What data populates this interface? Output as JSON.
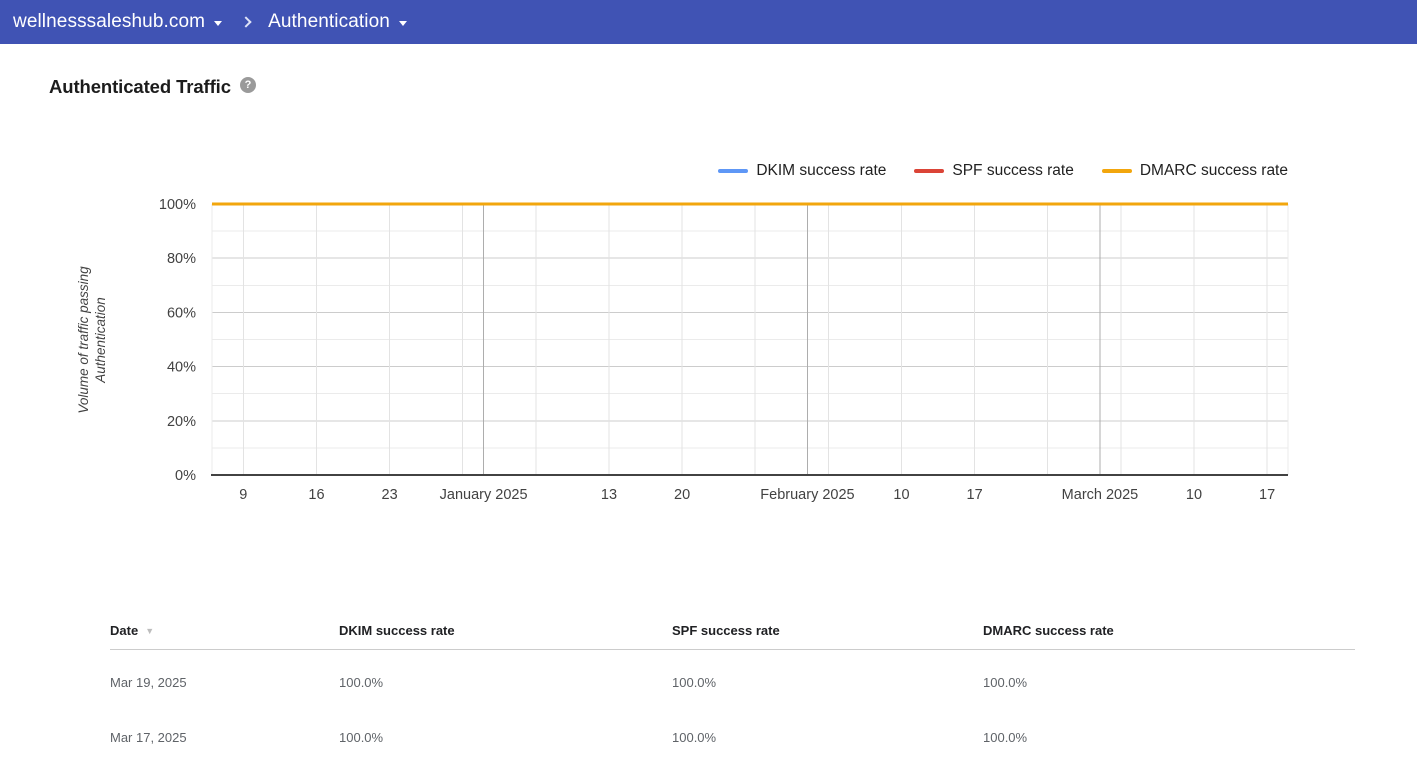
{
  "topbar": {
    "domain_label": "wellnesssaleshub.com",
    "section_label": "Authentication"
  },
  "icons": {
    "domain_caret": "caret-down-icon",
    "section_caret": "caret-down-icon",
    "breadcrumb_separator": "chevron-right-icon",
    "help": "help-icon",
    "sort": "sort-desc-icon"
  },
  "page": {
    "title": "Authenticated Traffic",
    "help_glyph": "?"
  },
  "chart_data": {
    "type": "line",
    "title": "Authenticated Traffic",
    "y_axis_title_lines": [
      "Volume of traffic passing",
      "Authentication"
    ],
    "ylim": [
      0,
      100
    ],
    "y_unit": "%",
    "grid": true,
    "legend_position": "top-right",
    "y_major_ticks": [
      {
        "value": 0,
        "label": "0%"
      },
      {
        "value": 20,
        "label": "20%"
      },
      {
        "value": 40,
        "label": "40%"
      },
      {
        "value": 60,
        "label": "60%"
      },
      {
        "value": 80,
        "label": "80%"
      },
      {
        "value": 100,
        "label": "100%"
      }
    ],
    "y_minor_tick_values": [
      10,
      30,
      50,
      70,
      90
    ],
    "x_axis": {
      "start_date": "Dec 6, 2024",
      "end_date": "Mar 19, 2025",
      "span_days": 103,
      "ticks": [
        {
          "day": 3,
          "label": "9",
          "kind": "week"
        },
        {
          "day": 10,
          "label": "16",
          "kind": "week"
        },
        {
          "day": 17,
          "label": "23",
          "kind": "week"
        },
        {
          "day": 24,
          "label": "",
          "kind": "week"
        },
        {
          "day": 26,
          "label": "January 2025",
          "kind": "month"
        },
        {
          "day": 31,
          "label": "",
          "kind": "week"
        },
        {
          "day": 38,
          "label": "13",
          "kind": "week"
        },
        {
          "day": 45,
          "label": "20",
          "kind": "week"
        },
        {
          "day": 52,
          "label": "",
          "kind": "week"
        },
        {
          "day": 57,
          "label": "February 2025",
          "kind": "month"
        },
        {
          "day": 59,
          "label": "",
          "kind": "week"
        },
        {
          "day": 66,
          "label": "10",
          "kind": "week"
        },
        {
          "day": 73,
          "label": "17",
          "kind": "week"
        },
        {
          "day": 80,
          "label": "",
          "kind": "week"
        },
        {
          "day": 85,
          "label": "March 2025",
          "kind": "month"
        },
        {
          "day": 87,
          "label": "",
          "kind": "week"
        },
        {
          "day": 94,
          "label": "10",
          "kind": "week"
        },
        {
          "day": 101,
          "label": "17",
          "kind": "week"
        }
      ]
    },
    "series": [
      {
        "name": "DKIM success rate",
        "color": "#5E97F6",
        "points": [
          {
            "day": 0,
            "value": 100
          },
          {
            "day": 103,
            "value": 100
          }
        ]
      },
      {
        "name": "SPF success rate",
        "color": "#DB4437",
        "points": [
          {
            "day": 0,
            "value": 100
          },
          {
            "day": 103,
            "value": 100
          }
        ]
      },
      {
        "name": "DMARC success rate",
        "color": "#F2A60D",
        "points": [
          {
            "day": 0,
            "value": 100
          },
          {
            "day": 103,
            "value": 100
          }
        ]
      }
    ]
  },
  "table": {
    "sort_indicator": "▼",
    "columns": [
      {
        "label": "Date",
        "sortable": true,
        "sort": "desc"
      },
      {
        "label": "DKIM success rate",
        "sortable": false
      },
      {
        "label": "SPF success rate",
        "sortable": false
      },
      {
        "label": "DMARC success rate",
        "sortable": false
      }
    ],
    "rows": [
      [
        "Mar 19, 2025",
        "100.0%",
        "100.0%",
        "100.0%"
      ],
      [
        "Mar 17, 2025",
        "100.0%",
        "100.0%",
        "100.0%"
      ]
    ]
  },
  "colors": {
    "topbar_bg": "#4053B4",
    "dkim": "#5E97F6",
    "spf": "#DB4437",
    "dmarc": "#F2A60D",
    "grid_major": "#CCCCCC",
    "grid_minor": "#EBEBEB",
    "grid_week": "#E3E3E3",
    "grid_month": "#ADADAD",
    "axis_baseline": "#424242",
    "axis_text": "#424242"
  }
}
